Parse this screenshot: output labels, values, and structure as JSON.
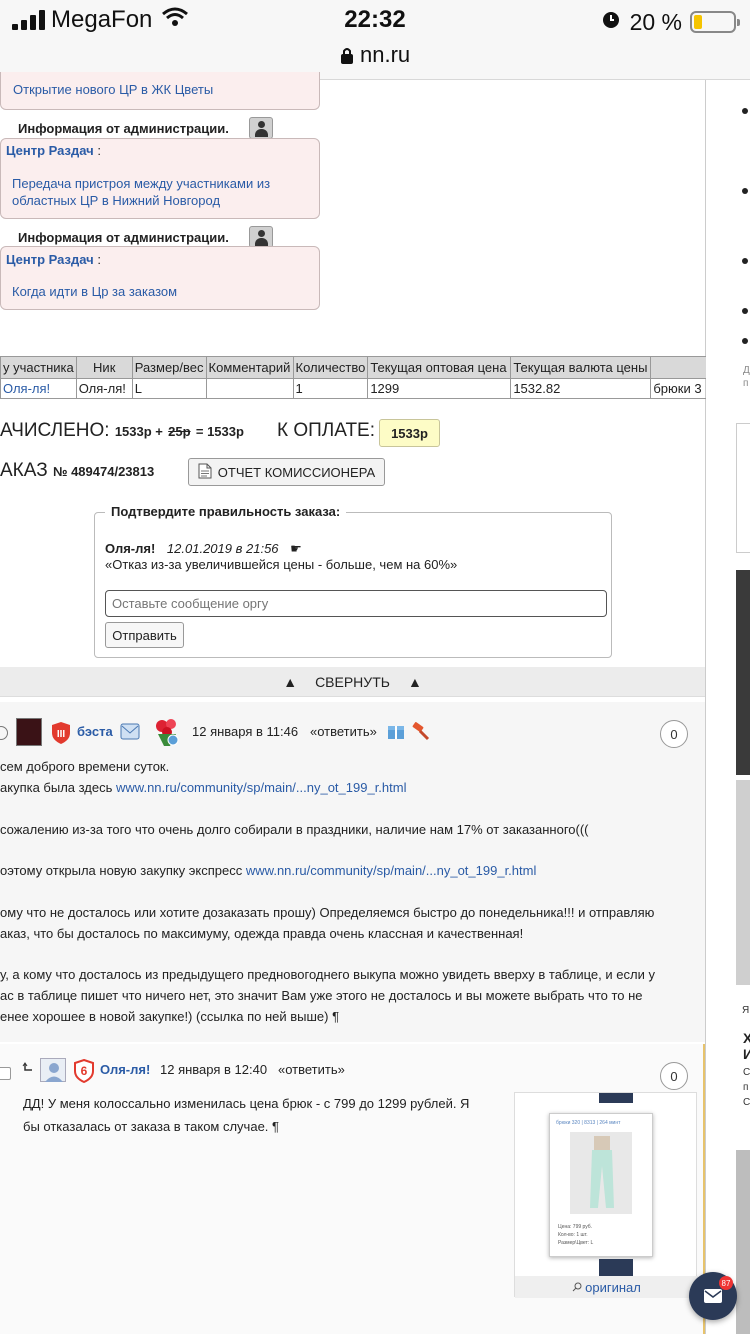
{
  "status_bar": {
    "carrier": "MegaFon",
    "time": "22:32",
    "battery": "20 %",
    "battery_level": 0.2,
    "url": "nn.ru"
  },
  "admin_notices": [
    {
      "title": "",
      "link": "Открытие нового ЦР в ЖК Цветы"
    },
    {
      "title": "Информация от администрации.",
      "author": "Центр Раздач",
      "sep": " :",
      "link": "Передача пристроя между участниками из областных ЦР в Нижний Новгород"
    },
    {
      "title": "Информация от администрации.",
      "author": "Центр Раздач",
      "sep": " :",
      "link": "Когда идти в Цр за заказом"
    }
  ],
  "order_table": {
    "headers": [
      "у участника",
      "Ник",
      "Размер/вес",
      "Комментарий",
      "Количество",
      "Текущая оптовая цена",
      "Текущая валюта цены",
      ""
    ],
    "row": [
      "Оля-ля!",
      "Оля-ля!",
      "L",
      "",
      "1",
      "1299",
      "1532.82",
      "брюки 3"
    ]
  },
  "totals": {
    "charged_label": "АЧИСЛЕНО:",
    "charged_value": "1533р +",
    "charged_strike": "25р",
    "charged_result": "= 1533р",
    "pay_label": "К ОПЛАТЕ:",
    "pay_value": "1533р"
  },
  "order": {
    "label": "АКАЗ",
    "number": "№ 489474/23813",
    "report_button": "ОТЧЕТ КОМИССИОНЕРА"
  },
  "confirm": {
    "legend": "Подтвердите правильность заказа:",
    "author": "Оля-ля!",
    "date": "12.01.2019 в 21:56",
    "pointer": "☛",
    "message": "«Отказ из-за увеличившейся цены - больше, чем на 60%»",
    "input_placeholder": "Оставьте сообщение оргу",
    "send_button": "Отправить"
  },
  "collapse": {
    "label": "СВЕРНУТЬ",
    "arrow": "▲"
  },
  "comment1": {
    "author": "бэста",
    "date": "12 января в 11:46",
    "reply": "«ответить»",
    "rating": "0",
    "lines": [
      {
        "text": "сем доброго времени суток."
      },
      {
        "text": "акупка была здесь ",
        "link": "www.nn.ru/community/sp/main/...ny_ot_199_r.html"
      },
      {
        "text": "сожалению из-за того что очень долго собирали в праздники, наличие нам 17% от заказанного((("
      },
      {
        "text": "оэтому открыла новую закупку экспресс ",
        "link": "www.nn.ru/community/sp/main/...ny_ot_199_r.html"
      },
      {
        "text": "ому что не досталось или хотите дозаказать прошу) Определяемся быстро до понедельника!!! и отправляю"
      },
      {
        "text": "аказ, что бы досталось по максимуму, одежда правда очень классная и качественная!"
      },
      {
        "text": "у, а кому что досталось из предыдущего предновогоднего выкупа можно увидеть вверху в таблице, и если у"
      },
      {
        "text": "ас в таблице пишет что ничего нет, это значит Вам уже этого не досталось и вы можете выбрать что то не"
      },
      {
        "text": "енее хорошее в новой закупке!) (ссылка по ней выше) ¶"
      }
    ]
  },
  "comment2": {
    "author": "Оля-ля!",
    "date": "12 января в 12:40",
    "reply": "«ответить»",
    "rating": "0",
    "lines": [
      "ДД! У меня колоссально изменилась цена брюк - с 799 до 1299 рублей. Я",
      "бы отказалась от заказа в таком случае. ¶"
    ],
    "image_caption": "оригинал",
    "image_title": "брюки 320 | 8313 | 264 минт",
    "image_price": "Цена: 799 руб.",
    "image_qty": "Кол-во: 1 шт.",
    "image_size": "Размер\\Цвет: L"
  },
  "fab": {
    "count": "87"
  },
  "sidebar_letters": [
    "Д",
    "п",
    "Я",
    "Х",
    "И",
    "С",
    "п",
    "С"
  ]
}
